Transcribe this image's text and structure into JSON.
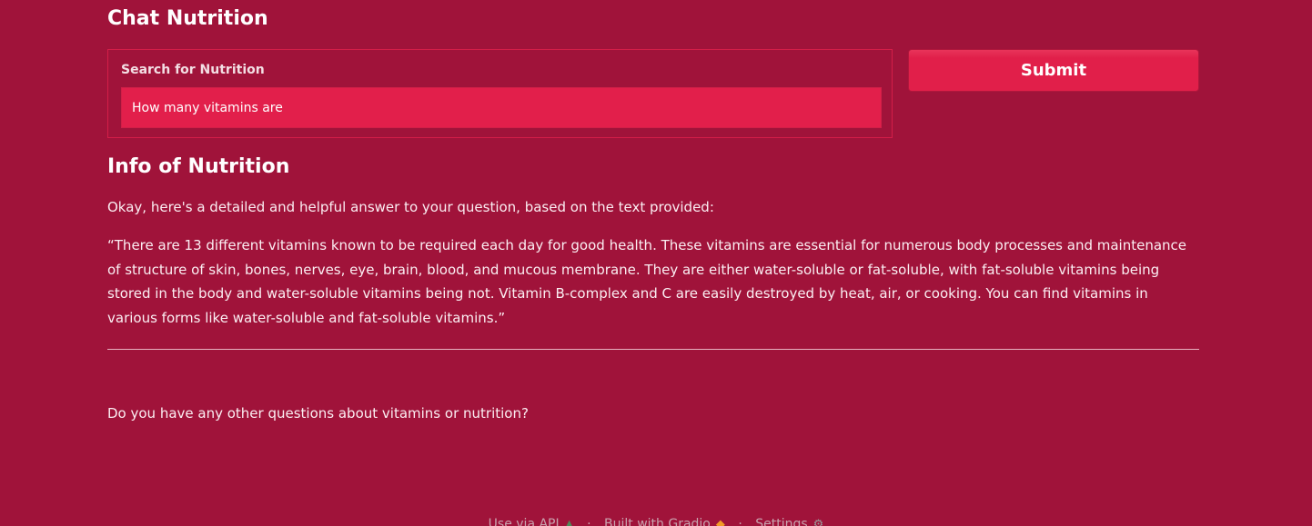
{
  "header": {
    "title": "Chat Nutrition"
  },
  "search": {
    "label": "Search for Nutrition",
    "value": "How many vitamins are",
    "placeholder": ""
  },
  "submit": {
    "label": "Submit"
  },
  "info": {
    "title": "Info of Nutrition",
    "intro": "Okay, here's a detailed and helpful answer to your question, based on the text provided:",
    "quote": "“There are 13 different vitamins known to be required each day for good health. These vitamins are essential for numerous body processes and maintenance of structure of skin, bones, nerves, eye, brain, blood, and mucous membrane. They are either water-soluble or fat-soluble, with fat-soluble vitamins being stored in the body and water-soluble vitamins being not. Vitamin B-complex and C are easily destroyed by heat, air, or cooking. You can find vitamins in various forms like water-soluble and fat-soluble vitamins.”",
    "followup": "Do you have any other questions about vitamins or nutrition?"
  },
  "footer": {
    "api_label": "Use via API",
    "api_icon": "rocket-icon",
    "separator": "·",
    "gradio_label": "Built with Gradio",
    "gradio_icon": "gradio-logo-icon",
    "settings_label": "Settings",
    "settings_icon": "gear-icon"
  },
  "colors": {
    "background": "#a0133a",
    "accent": "#e21f4b"
  }
}
